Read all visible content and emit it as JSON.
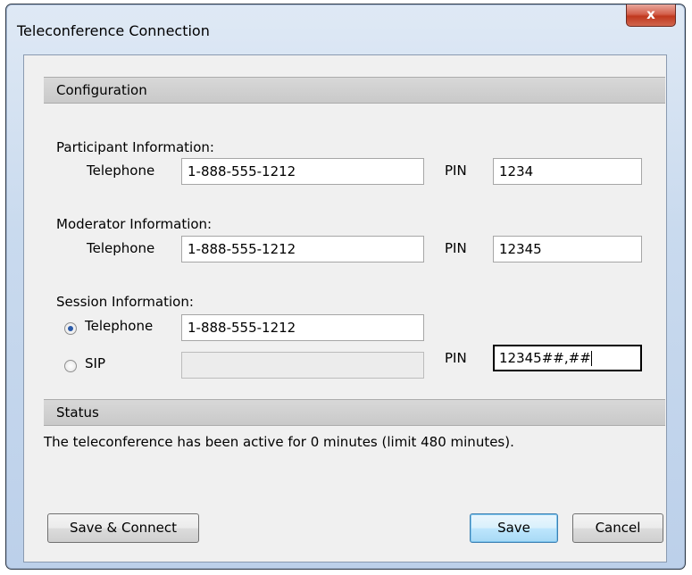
{
  "window": {
    "title": "Teleconference Connection",
    "close_label": "x"
  },
  "configuration": {
    "header": "Configuration",
    "participant": {
      "group_label": "Participant Information:",
      "telephone_label": "Telephone",
      "telephone_value": "1-888-555-1212",
      "pin_label": "PIN",
      "pin_value": "1234"
    },
    "moderator": {
      "group_label": "Moderator Information:",
      "telephone_label": "Telephone",
      "telephone_value": "1-888-555-1212",
      "pin_label": "PIN",
      "pin_value": "12345"
    },
    "session": {
      "group_label": "Session Information:",
      "telephone_option": "Telephone",
      "telephone_selected": true,
      "telephone_value": "1-888-555-1212",
      "sip_option": "SIP",
      "sip_value": "",
      "pin_label": "PIN",
      "pin_value": "12345##,##"
    }
  },
  "status": {
    "header": "Status",
    "message": "The teleconference has been active for 0 minutes (limit 480 minutes)."
  },
  "buttons": {
    "save_connect": "Save & Connect",
    "save": "Save",
    "cancel": "Cancel"
  }
}
